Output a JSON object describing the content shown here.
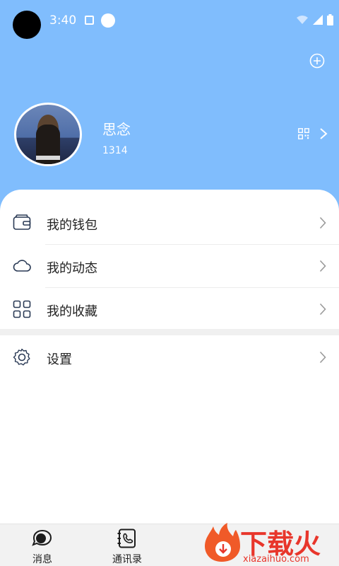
{
  "status_bar": {
    "time": "3:40"
  },
  "profile": {
    "name": "思念",
    "id": "1314"
  },
  "menu": [
    {
      "label": "我的钱包",
      "icon": "wallet-icon"
    },
    {
      "label": "我的动态",
      "icon": "cloud-icon"
    },
    {
      "label": "我的收藏",
      "icon": "favorites-grid-icon"
    }
  ],
  "settings": {
    "label": "设置",
    "icon": "gear-icon"
  },
  "tabbar": [
    {
      "label": "消息",
      "icon": "chat-bubble-icon"
    },
    {
      "label": "通讯录",
      "icon": "contacts-book-icon"
    }
  ],
  "watermark": {
    "title": "下载火",
    "url": "xiazaihuo.com"
  },
  "colors": {
    "header": "#80bdfd",
    "accent": "#e8362b",
    "icon_stroke": "#2a3a55"
  }
}
